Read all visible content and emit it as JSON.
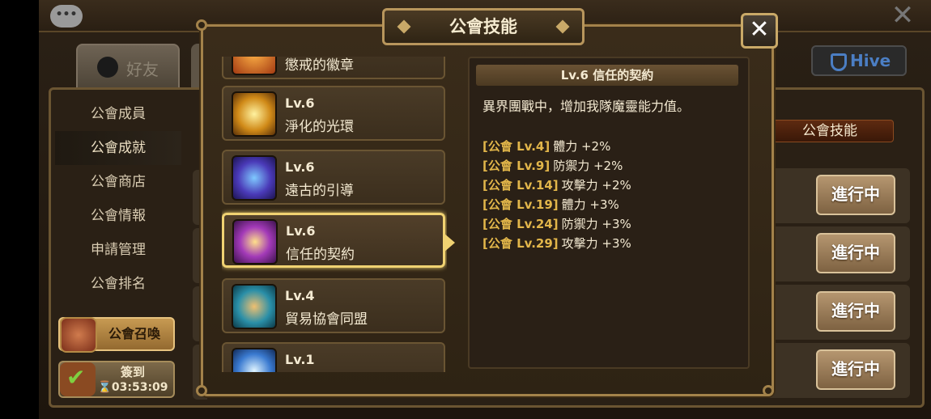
{
  "background": {
    "friends_tab": "好友",
    "hive_label": "Hive",
    "menu": [
      {
        "label": "公會成員"
      },
      {
        "label": "公會成就"
      },
      {
        "label": "公會商店"
      },
      {
        "label": "公會情報"
      },
      {
        "label": "申請管理"
      },
      {
        "label": "公會排名"
      }
    ],
    "summon_label": "公會召喚",
    "checkin_label": "簽到",
    "checkin_timer": "⌛03:53:09",
    "guild_skill_tag": "公會技能",
    "progress_labels": [
      "進行中",
      "進行中",
      "進行中",
      "進行中"
    ]
  },
  "modal": {
    "title": "公會技能",
    "close_label": "✕",
    "skills": [
      {
        "level": "",
        "name": "懲戒的徽章"
      },
      {
        "level": "Lv.6",
        "name": "淨化的光環"
      },
      {
        "level": "Lv.6",
        "name": "遠古的引導"
      },
      {
        "level": "Lv.6",
        "name": "信任的契約"
      },
      {
        "level": "Lv.4",
        "name": "貿易協會同盟"
      },
      {
        "level": "Lv.1",
        "name": ""
      }
    ],
    "detail": {
      "header": "Lv.6 信任的契約",
      "description": "異界團戰中，增加我隊魔靈能力值。",
      "bonuses": [
        {
          "req": "[公會 Lv.4]",
          "effect": "體力 +2%"
        },
        {
          "req": "[公會 Lv.9]",
          "effect": "防禦力 +2%"
        },
        {
          "req": "[公會 Lv.14]",
          "effect": "攻擊力 +2%"
        },
        {
          "req": "[公會 Lv.19]",
          "effect": "體力 +3%"
        },
        {
          "req": "[公會 Lv.24]",
          "effect": "防禦力 +3%"
        },
        {
          "req": "[公會 Lv.29]",
          "effect": "攻擊力 +3%"
        }
      ]
    }
  },
  "colors": {
    "gold_border": "#a3824a",
    "selected_border": "#f0d272",
    "bonus_req": "#e2b64a",
    "text": "#f4ead2"
  }
}
